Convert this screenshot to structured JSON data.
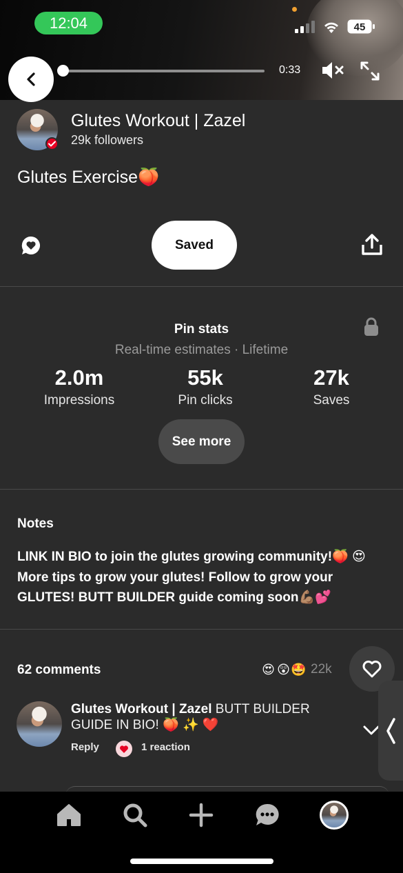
{
  "status_bar": {
    "time": "12:04",
    "battery": "45"
  },
  "video": {
    "elapsed": "0:33",
    "progress": 0.0
  },
  "creator": {
    "name": "Glutes Workout | Zazel",
    "followers": "29k followers"
  },
  "pin": {
    "title": "Glutes Exercise🍑",
    "saved_label": "Saved"
  },
  "stats": {
    "title": "Pin stats",
    "subtitle": "Real-time estimates · Lifetime",
    "items": [
      {
        "value": "2.0m",
        "label": "Impressions"
      },
      {
        "value": "55k",
        "label": "Pin clicks"
      },
      {
        "value": "27k",
        "label": "Saves"
      }
    ],
    "see_more_label": "See more"
  },
  "notes": {
    "title": "Notes",
    "body": "LINK IN BIO to join the glutes growing community!🍑 😍 More tips to grow your glutes! Follow to grow your GLUTES! BUTT BUILDER guide coming soon💪🏽💕"
  },
  "comments": {
    "count_label": "62 comments",
    "reaction_emojis": [
      "😍",
      "😲",
      "🤩"
    ],
    "reaction_total": "22k",
    "first": {
      "author": "Glutes Workout | Zazel",
      "text": " BUTT BUILDER GUIDE IN BIO! 🍑 ✨ ❤️",
      "reply_label": "Reply",
      "reaction_label": "1 reaction"
    }
  },
  "colors": {
    "accent_green": "#34c759",
    "brand_red": "#e60023",
    "surface": "#2b2b2b"
  },
  "icons": {
    "nav": [
      "home-icon",
      "search-icon",
      "plus-icon",
      "messages-icon",
      "profile-avatar"
    ],
    "actions": [
      "comment-icon",
      "share-icon",
      "lock-icon",
      "heart-icon",
      "chevron-down-icon"
    ]
  }
}
